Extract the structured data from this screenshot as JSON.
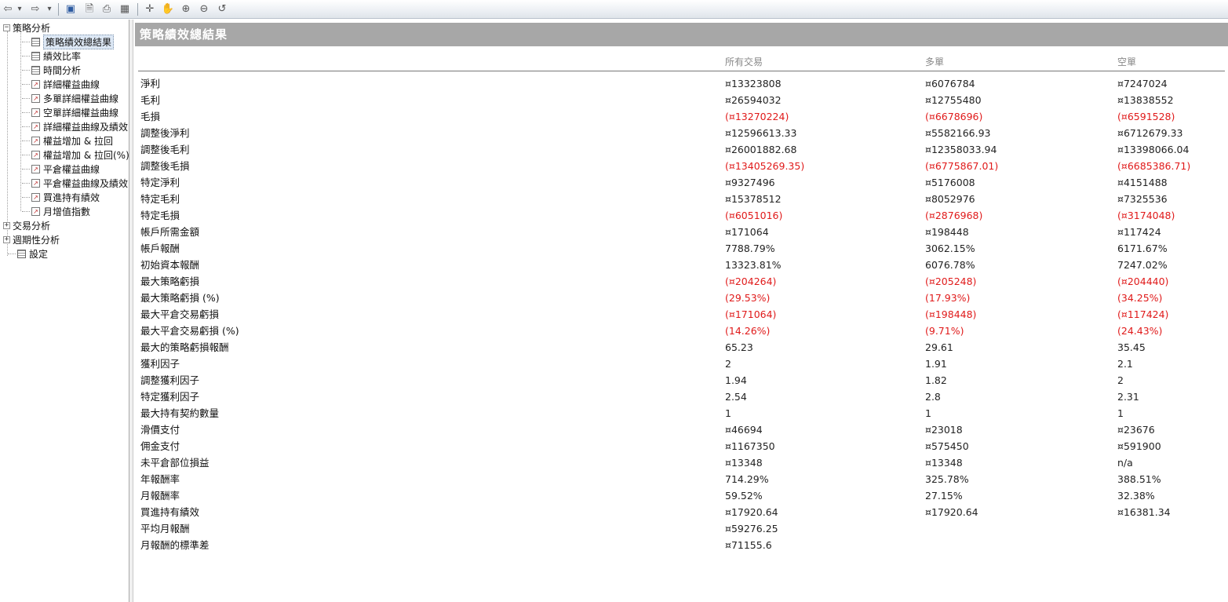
{
  "toolbar": {
    "buttons": [
      {
        "name": "back-icon",
        "glyph": "⇦"
      },
      {
        "name": "back-dropdown-icon",
        "glyph": "▾"
      },
      {
        "name": "forward-icon",
        "glyph": "⇨"
      },
      {
        "name": "forward-dropdown-icon",
        "glyph": "▾"
      },
      {
        "name": "save-icon",
        "glyph": "▣"
      },
      {
        "name": "print-preview-icon",
        "glyph": "🗎"
      },
      {
        "name": "print-icon",
        "glyph": "⎙"
      },
      {
        "name": "table-view-icon",
        "glyph": "▦"
      },
      {
        "name": "crosshair-icon",
        "glyph": "✛"
      },
      {
        "name": "pan-hand-icon",
        "glyph": "✋"
      },
      {
        "name": "zoom-in-icon",
        "glyph": "⊕"
      },
      {
        "name": "zoom-out-icon",
        "glyph": "⊖"
      },
      {
        "name": "reset-zoom-icon",
        "glyph": "↺"
      }
    ]
  },
  "sidebar": {
    "root_items": [
      {
        "label": "策略分析",
        "expander": "−"
      },
      {
        "label": "交易分析",
        "expander": "+"
      },
      {
        "label": "週期性分析",
        "expander": "+"
      },
      {
        "label": "設定",
        "expander": ""
      }
    ],
    "strategy_items": [
      {
        "label": "策略績效總結果",
        "icon": "table-icon",
        "selected": true
      },
      {
        "label": "績效比率",
        "icon": "table-icon"
      },
      {
        "label": "時間分析",
        "icon": "table-icon"
      },
      {
        "label": "詳細權益曲線",
        "icon": "chart-icon"
      },
      {
        "label": "多單詳細權益曲線",
        "icon": "chart-icon"
      },
      {
        "label": "空單詳細權益曲線",
        "icon": "chart-icon"
      },
      {
        "label": "詳細權益曲線及績效",
        "icon": "chart-icon"
      },
      {
        "label": "權益增加 & 拉回",
        "icon": "chart-icon"
      },
      {
        "label": "權益增加 & 拉回(%)",
        "icon": "chart-icon"
      },
      {
        "label": "平倉權益曲線",
        "icon": "chart-icon"
      },
      {
        "label": "平倉權益曲線及績效",
        "icon": "chart-icon"
      },
      {
        "label": "買進持有績效",
        "icon": "chart-icon"
      },
      {
        "label": "月增值指數",
        "icon": "chart-icon"
      }
    ]
  },
  "main": {
    "title": "策略績效總結果",
    "columns": [
      "所有交易",
      "多單",
      "空單"
    ],
    "rows": [
      {
        "label": "淨利",
        "all": "¤13323808",
        "long": "¤6076784",
        "short": "¤7247024",
        "neg": false
      },
      {
        "label": "毛利",
        "all": "¤26594032",
        "long": "¤12755480",
        "short": "¤13838552",
        "neg": false
      },
      {
        "label": "毛損",
        "all": "(¤13270224)",
        "long": "(¤6678696)",
        "short": "(¤6591528)",
        "neg": true
      },
      {
        "label": "調整後淨利",
        "all": "¤12596613.33",
        "long": "¤5582166.93",
        "short": "¤6712679.33",
        "neg": false
      },
      {
        "label": "調整後毛利",
        "all": "¤26001882.68",
        "long": "¤12358033.94",
        "short": "¤13398066.04",
        "neg": false
      },
      {
        "label": "調整後毛損",
        "all": "(¤13405269.35)",
        "long": "(¤6775867.01)",
        "short": "(¤6685386.71)",
        "neg": true
      },
      {
        "label": "特定淨利",
        "all": "¤9327496",
        "long": "¤5176008",
        "short": "¤4151488",
        "neg": false
      },
      {
        "label": "特定毛利",
        "all": "¤15378512",
        "long": "¤8052976",
        "short": "¤7325536",
        "neg": false
      },
      {
        "label": "特定毛損",
        "all": "(¤6051016)",
        "long": "(¤2876968)",
        "short": "(¤3174048)",
        "neg": true
      },
      {
        "label": "帳戶所需金額",
        "all": "¤171064",
        "long": "¤198448",
        "short": "¤117424",
        "neg": false
      },
      {
        "label": "帳戶報酬",
        "all": "7788.79%",
        "long": "3062.15%",
        "short": "6171.67%",
        "neg": false
      },
      {
        "label": "初始資本報酬",
        "all": "13323.81%",
        "long": "6076.78%",
        "short": "7247.02%",
        "neg": false
      },
      {
        "label": "最大策略虧損",
        "all": "(¤204264)",
        "long": "(¤205248)",
        "short": "(¤204440)",
        "neg": true
      },
      {
        "label": "最大策略虧損 (%)",
        "all": "(29.53%)",
        "long": "(17.93%)",
        "short": "(34.25%)",
        "neg": true
      },
      {
        "label": "最大平倉交易虧損",
        "all": "(¤171064)",
        "long": "(¤198448)",
        "short": "(¤117424)",
        "neg": true
      },
      {
        "label": "最大平倉交易虧損 (%)",
        "all": "(14.26%)",
        "long": "(9.71%)",
        "short": "(24.43%)",
        "neg": true
      },
      {
        "label": "最大的策略虧損報酬",
        "all": "65.23",
        "long": "29.61",
        "short": "35.45",
        "neg": false
      },
      {
        "label": "獲利因子",
        "all": "2",
        "long": "1.91",
        "short": "2.1",
        "neg": false
      },
      {
        "label": "調整獲利因子",
        "all": "1.94",
        "long": "1.82",
        "short": "2",
        "neg": false
      },
      {
        "label": "特定獲利因子",
        "all": "2.54",
        "long": "2.8",
        "short": "2.31",
        "neg": false
      },
      {
        "label": "最大持有契約數量",
        "all": "1",
        "long": "1",
        "short": "1",
        "neg": false
      },
      {
        "label": "滑價支付",
        "all": "¤46694",
        "long": "¤23018",
        "short": "¤23676",
        "neg": false
      },
      {
        "label": "佣金支付",
        "all": "¤1167350",
        "long": "¤575450",
        "short": "¤591900",
        "neg": false
      },
      {
        "label": "未平倉部位損益",
        "all": "¤13348",
        "long": "¤13348",
        "short": "n/a",
        "neg": false
      },
      {
        "label": "年報酬率",
        "all": "714.29%",
        "long": "325.78%",
        "short": "388.51%",
        "neg": false
      },
      {
        "label": "月報酬率",
        "all": "59.52%",
        "long": "27.15%",
        "short": "32.38%",
        "neg": false
      },
      {
        "label": "買進持有績效",
        "all": "¤17920.64",
        "long": "¤17920.64",
        "short": "¤16381.34",
        "neg": false
      },
      {
        "label": "平均月報酬",
        "all": "¤59276.25",
        "long": "",
        "short": "",
        "neg": false
      },
      {
        "label": "月報酬的標準差",
        "all": "¤71155.6",
        "long": "",
        "short": "",
        "neg": false
      }
    ]
  }
}
